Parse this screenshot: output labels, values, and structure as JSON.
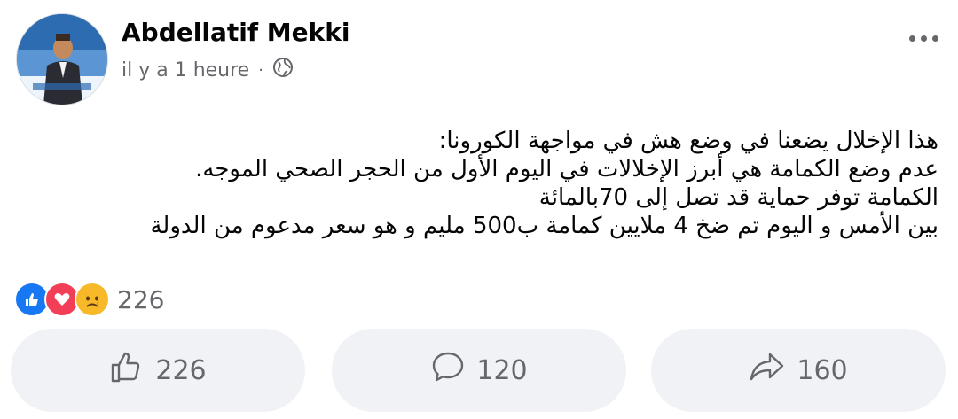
{
  "post": {
    "author": "Abdellatif Mekki",
    "timestamp": "il y a 1 heure",
    "separator": "·",
    "privacy_icon": "globe-icon",
    "lines": [
      "هذا الإخلال يضعنا في وضع هش في مواجهة الكورونا:",
      "عدم وضع الكمامة هي أبرز الإخلالات  في اليوم الأول من الحجر الصحي الموجه.",
      "الكمامة توفر حماية قد تصل إلى 70بالمائة",
      "بين الأمس و اليوم تم ضخ 4 ملايين كمامة ب500 مليم و هو سعر مدعوم من الدولة"
    ]
  },
  "reactions": {
    "types": [
      "like",
      "love",
      "sad"
    ],
    "count": "226"
  },
  "actions": {
    "like_count": "226",
    "comment_count": "120",
    "share_count": "160"
  },
  "colors": {
    "like": "#1877f2",
    "love": "#f33e58",
    "sad": "#f7b928",
    "button_bg": "#f0f2f5",
    "secondary_text": "#65676b"
  }
}
